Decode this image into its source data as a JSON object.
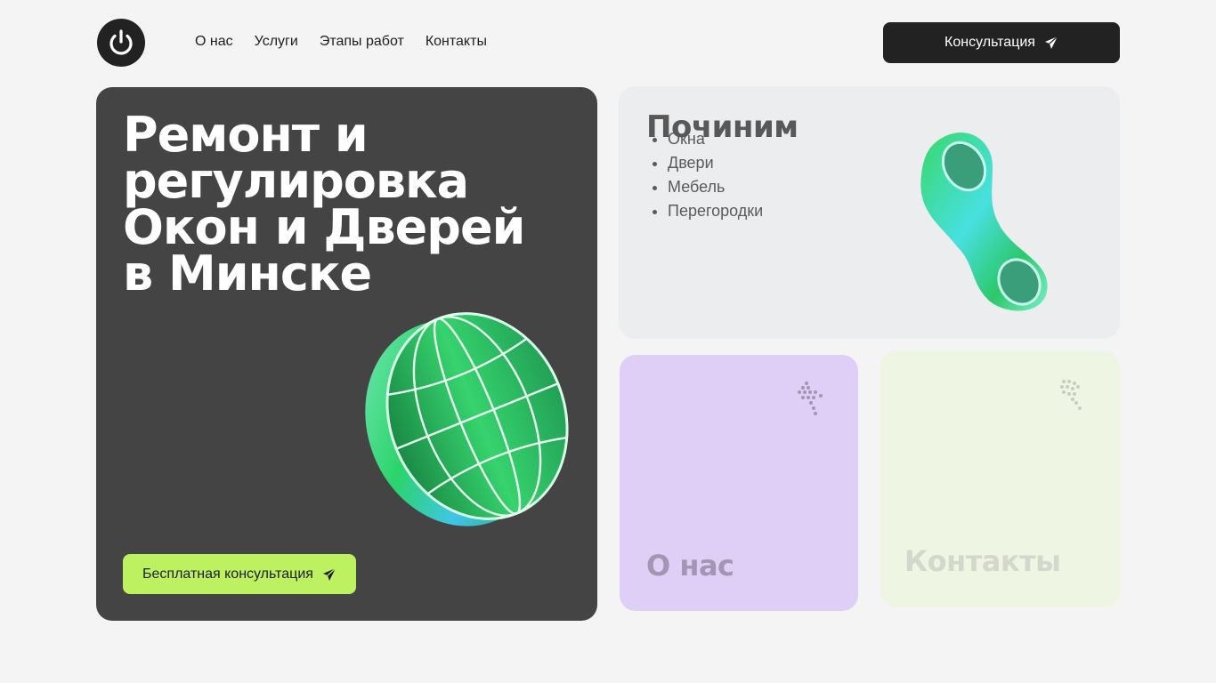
{
  "header": {
    "nav": [
      "О нас",
      "Услуги",
      "Этапы работ",
      "Контакты"
    ],
    "consult_label": "Консультация"
  },
  "hero": {
    "title_lines": [
      "Ремонт и",
      "регулировка",
      "Окон и Дверей",
      "в Минске"
    ],
    "cta_label": "Бесплатная консультация"
  },
  "services": {
    "title": "Починим",
    "items": [
      "Окна",
      "Двери",
      "Мебель",
      "Перегородки"
    ]
  },
  "about_card": {
    "label": "О нас"
  },
  "contacts_card": {
    "label": "Контакты"
  },
  "icons": {
    "logo": "power-icon",
    "send": "paper-plane-icon",
    "arrow": "dotted-arrow-icon"
  },
  "colors": {
    "page_bg": "#f4f4f4",
    "dark": "#222222",
    "hero_bg": "#444444",
    "accent_lime": "#bdf160",
    "services_bg": "#ecedef",
    "about_bg": "#dfcff7",
    "contacts_bg": "#eef5e3"
  }
}
